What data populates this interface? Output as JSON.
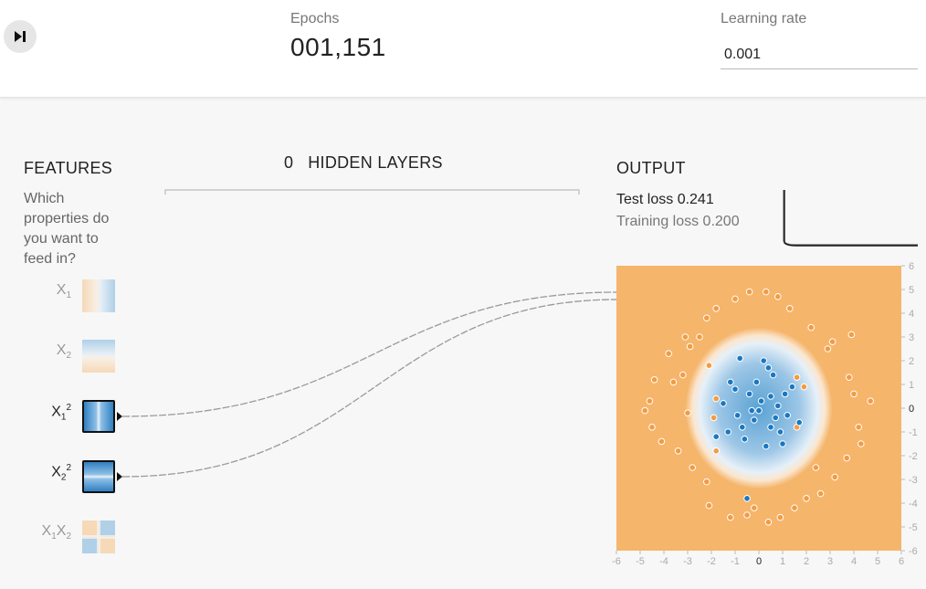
{
  "controls": {
    "play_icon": "step-forward-icon",
    "epochs_label": "Epochs",
    "epochs_value": "001,151",
    "learning_rate_label": "Learning rate",
    "learning_rate_value": "0.001"
  },
  "features": {
    "title": "FEATURES",
    "description": "Which properties do you want to feed in?",
    "items": [
      {
        "label_base": "X",
        "label_sub": "1",
        "active": false
      },
      {
        "label_base": "X",
        "label_sub": "2",
        "active": false
      },
      {
        "label_base": "X",
        "label_sub": "1",
        "label_sup": "2",
        "active": true
      },
      {
        "label_base": "X",
        "label_sub": "2",
        "label_sup": "2",
        "active": true
      },
      {
        "label_base": "X",
        "label_sub": "1",
        "label_base2": "X",
        "label_sub2": "2",
        "active": false
      }
    ]
  },
  "hidden": {
    "count": "0",
    "title": "HIDDEN LAYERS"
  },
  "output": {
    "title": "OUTPUT",
    "test_loss": "Test loss 0.241",
    "training_loss": "Training loss 0.200"
  },
  "colors": {
    "orange": "#f59b42",
    "blue": "#1a78c2",
    "bg_orange": "#f5b56b",
    "bg_blue": "#5aa2d4"
  },
  "chart_data": {
    "type": "scatter",
    "xlim": [
      -6,
      6
    ],
    "ylim": [
      -6,
      6
    ],
    "x_ticks": [
      "-6",
      "-5",
      "-4",
      "-3",
      "-2",
      "-1",
      "0",
      "1",
      "2",
      "3",
      "4",
      "5",
      "6"
    ],
    "y_ticks": [
      "6",
      "5",
      "4",
      "3",
      "2",
      "1",
      "0",
      "-1",
      "-2",
      "-3",
      "-4",
      "-5",
      "-6"
    ],
    "decision_boundary": "circle centered at origin, radius ~2.5",
    "series": [
      {
        "class": "orange",
        "points": [
          [
            -4.8,
            -0.1
          ],
          [
            -4.6,
            0.3
          ],
          [
            -4.4,
            1.2
          ],
          [
            -4.1,
            -1.4
          ],
          [
            -4.5,
            -0.8
          ],
          [
            -3.4,
            -1.8
          ],
          [
            -3.6,
            1.1
          ],
          [
            -3.2,
            1.4
          ],
          [
            -2.9,
            2.6
          ],
          [
            -2.5,
            3.0
          ],
          [
            -3.1,
            3.0
          ],
          [
            -2.2,
            3.8
          ],
          [
            -1.8,
            4.2
          ],
          [
            -1.0,
            4.6
          ],
          [
            -0.4,
            4.9
          ],
          [
            0.3,
            4.9
          ],
          [
            0.8,
            4.7
          ],
          [
            1.3,
            4.2
          ],
          [
            2.2,
            3.4
          ],
          [
            2.9,
            2.5
          ],
          [
            3.1,
            2.8
          ],
          [
            3.8,
            1.3
          ],
          [
            4.0,
            0.6
          ],
          [
            4.2,
            -0.8
          ],
          [
            4.3,
            -1.5
          ],
          [
            3.7,
            -2.1
          ],
          [
            3.2,
            -2.9
          ],
          [
            2.6,
            -3.6
          ],
          [
            2.0,
            -3.8
          ],
          [
            1.5,
            -4.2
          ],
          [
            0.9,
            -4.6
          ],
          [
            0.4,
            -4.8
          ],
          [
            -0.5,
            -4.5
          ],
          [
            -1.2,
            -4.6
          ],
          [
            -2.1,
            -4.1
          ],
          [
            -2.2,
            -3.1
          ],
          [
            -2.8,
            -2.5
          ],
          [
            -1.8,
            -1.8
          ],
          [
            -1.8,
            0.4
          ],
          [
            -1.9,
            -0.4
          ],
          [
            1.6,
            -0.8
          ],
          [
            1.6,
            1.3
          ],
          [
            -0.2,
            -4.2
          ],
          [
            -3.0,
            -0.2
          ],
          [
            4.7,
            0.3
          ],
          [
            3.9,
            3.1
          ],
          [
            -3.8,
            2.3
          ],
          [
            1.9,
            0.9
          ],
          [
            -2.1,
            1.8
          ],
          [
            2.4,
            -2.5
          ]
        ]
      },
      {
        "class": "blue",
        "points": [
          [
            -0.8,
            2.1
          ],
          [
            0.2,
            2.0
          ],
          [
            -1.2,
            1.1
          ],
          [
            0.6,
            1.4
          ],
          [
            1.4,
            0.9
          ],
          [
            -1.5,
            0.2
          ],
          [
            -0.4,
            0.6
          ],
          [
            0.1,
            0.3
          ],
          [
            0.8,
            0.1
          ],
          [
            -0.9,
            -0.3
          ],
          [
            -0.2,
            -0.5
          ],
          [
            0.5,
            -0.8
          ],
          [
            1.2,
            -0.3
          ],
          [
            -1.3,
            -1.0
          ],
          [
            -0.6,
            -1.3
          ],
          [
            0.3,
            -1.6
          ],
          [
            1.0,
            -1.5
          ],
          [
            -1.8,
            -1.2
          ],
          [
            1.7,
            -0.6
          ],
          [
            -0.5,
            -3.8
          ],
          [
            0.4,
            1.7
          ],
          [
            -0.1,
            1.1
          ],
          [
            -1.0,
            0.8
          ],
          [
            1.1,
            0.6
          ],
          [
            0.7,
            -0.4
          ],
          [
            -0.7,
            -0.8
          ],
          [
            0.0,
            -0.1
          ],
          [
            0.5,
            0.5
          ],
          [
            -0.3,
            -0.1
          ],
          [
            0.9,
            -1.0
          ]
        ]
      }
    ]
  }
}
